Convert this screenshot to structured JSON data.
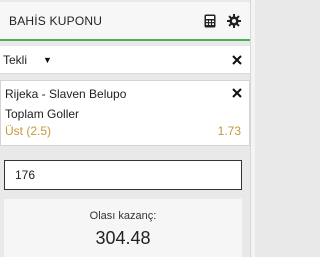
{
  "header": {
    "title": "BAHİS KUPONU",
    "icons": [
      "calculator-icon",
      "gear-icon"
    ]
  },
  "bet_type": {
    "selected": "Tekli",
    "close_icon": "close-icon"
  },
  "selection": {
    "match": "Rijeka - Slaven Belupo",
    "market": "Toplam Goller",
    "pick": "Üst (2.5)",
    "odds": "1.73",
    "pick_color": "#c8963c"
  },
  "stake": {
    "value": "176"
  },
  "winnings": {
    "label": "Olası kazanç:",
    "value": "304.48"
  },
  "colors": {
    "accent_green": "#4caf50",
    "odds_gold": "#c8963c"
  }
}
